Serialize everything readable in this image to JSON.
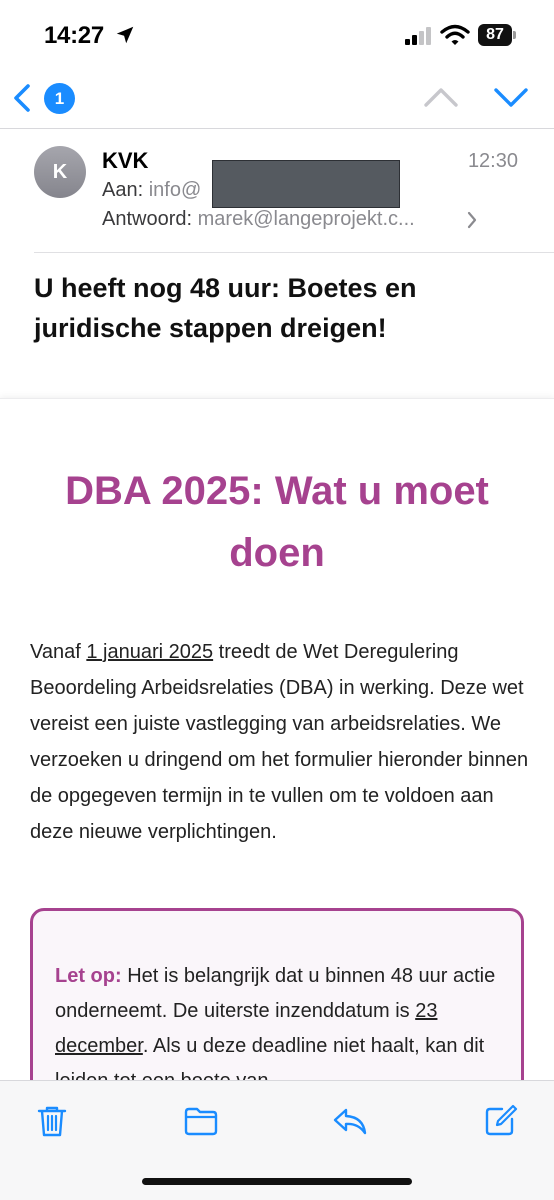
{
  "status_bar": {
    "time": "14:27",
    "battery_level": "87",
    "icons": [
      "location-arrow-icon",
      "signal-icon",
      "wifi-icon",
      "battery-icon"
    ]
  },
  "nav": {
    "unread_count": "1",
    "icons": [
      "back-chevron-icon",
      "up-chevron-icon",
      "down-chevron-icon"
    ],
    "accent_color": "#1a8cff"
  },
  "header": {
    "avatar_initial": "K",
    "sender": "KVK",
    "time": "12:30",
    "to_label": "Aan:",
    "to_value": "info@",
    "reply_label": "Antwoord:",
    "reply_value": "marek@langeprojekt.c..."
  },
  "subject": "U heeft nog 48 uur: Boetes en juridische stappen dreigen!",
  "body": {
    "title": "DBA 2025: Wat u moet doen",
    "title_color": "#a6428f",
    "paragraph_before": "Vanaf ",
    "paragraph_date": "1 januari 2025",
    "paragraph_after": " treedt de Wet Deregulering Beoordeling Arbeidsrelaties (DBA) in werking. Deze wet vereist een juiste vastlegging van arbeidsrelaties. We verzoeken u dringend om het formulier hieronder binnen de opgegeven termijn in te vullen om te voldoen aan deze nieuwe verplichtingen.",
    "notice_label": "Let op:",
    "notice_before": " Het is belangrijk dat u binnen 48 uur actie onderneemt. De uiterste inzenddatum is ",
    "notice_date": "23 december",
    "notice_after": ". Als u deze deadline niet haalt, kan dit leiden tot een boete van"
  },
  "toolbar": {
    "icons": [
      "trash-icon",
      "folder-icon",
      "reply-icon",
      "compose-icon"
    ]
  }
}
